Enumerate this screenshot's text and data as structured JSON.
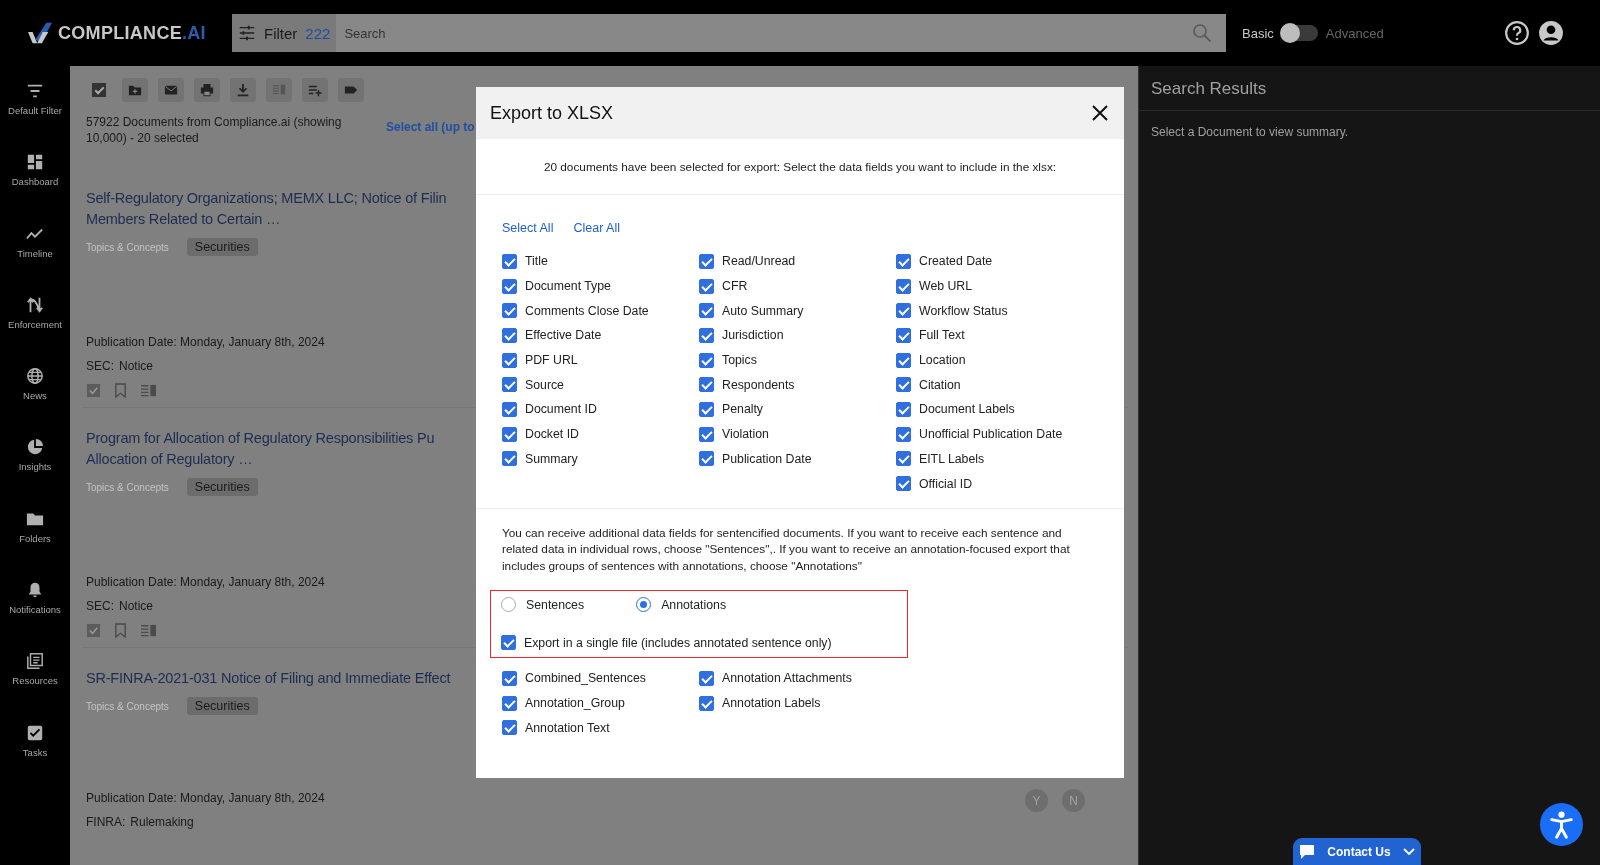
{
  "header": {
    "logo": "COMPLIANCE",
    "logo_suffix": ".AI",
    "filter_label": "Filter",
    "filter_count": "222",
    "search": {
      "placeholder": "Search"
    },
    "mode_toggle": {
      "left_label": "Basic",
      "right_label": "Advanced",
      "on": false
    }
  },
  "sidebar": {
    "items": [
      {
        "label": "Default Filter"
      },
      {
        "label": "Dashboard"
      },
      {
        "label": "Timeline"
      },
      {
        "label": "Enforcement"
      },
      {
        "label": "News"
      },
      {
        "label": "Insights"
      },
      {
        "label": "Folders"
      },
      {
        "label": "Notifications"
      },
      {
        "label": "Resources"
      },
      {
        "label": "Tasks"
      }
    ]
  },
  "results": {
    "select_all_checked": true,
    "summary": "57922 Documents from Compliance.ai (showing 10,000) - 20 selected",
    "select_all_link": "Select all (up to",
    "documents": [
      {
        "title_lines": [
          "Self-Regulatory Organizations; MEMX LLC; Notice of Filin",
          "Members Related to Certain …"
        ],
        "tag_label": "Topics & Concepts",
        "tag": "Securities",
        "publication_date": "Publication Date: Monday, January 8th, 2024",
        "agency": "SEC:",
        "doc_type": "Notice"
      },
      {
        "title_lines": [
          "Program for Allocation of Regulatory Responsibilities Pu",
          "Allocation of Regulatory …"
        ],
        "tag_label": "Topics & Concepts",
        "tag": "Securities",
        "publication_date": "Publication Date: Monday, January 8th, 2024",
        "agency": "SEC:",
        "doc_type": "Notice"
      },
      {
        "title_lines": [
          "SR-FINRA-2021-031 Notice of Filing and Immediate Effect"
        ],
        "tag_label": "Topics & Concepts",
        "tag": "Securities",
        "publication_date": "Publication Date: Monday, January 8th, 2024",
        "agency": "FINRA:",
        "doc_type": "Rulemaking"
      }
    ],
    "feedback": [
      "Y",
      "N"
    ]
  },
  "right_panel": {
    "title": "Search Results",
    "message": "Select a Document to view summary."
  },
  "modal": {
    "title": "Export to XLSX",
    "intro": "20 documents have been selected for export: Select the data fields you want to include in the xlsx:",
    "select_all": "Select All",
    "clear_all": "Clear All",
    "field_columns": [
      [
        {
          "label": "Title",
          "checked": true
        },
        {
          "label": "Document Type",
          "checked": true
        },
        {
          "label": "Comments Close Date",
          "checked": true
        },
        {
          "label": "Effective Date",
          "checked": true
        },
        {
          "label": "PDF URL",
          "checked": true
        },
        {
          "label": "Source",
          "checked": true
        },
        {
          "label": "Document ID",
          "checked": true
        },
        {
          "label": "Docket ID",
          "checked": true
        },
        {
          "label": "Summary",
          "checked": true
        }
      ],
      [
        {
          "label": "Read/Unread",
          "checked": true
        },
        {
          "label": "CFR",
          "checked": true
        },
        {
          "label": "Auto Summary",
          "checked": true
        },
        {
          "label": "Jurisdiction",
          "checked": true
        },
        {
          "label": "Topics",
          "checked": true
        },
        {
          "label": "Respondents",
          "checked": true
        },
        {
          "label": "Penalty",
          "checked": true
        },
        {
          "label": "Violation",
          "checked": true
        },
        {
          "label": "Publication Date",
          "checked": true
        }
      ],
      [
        {
          "label": "Created Date",
          "checked": true
        },
        {
          "label": "Web URL",
          "checked": true
        },
        {
          "label": "Workflow Status",
          "checked": true
        },
        {
          "label": "Full Text",
          "checked": true
        },
        {
          "label": "Location",
          "checked": true
        },
        {
          "label": "Citation",
          "checked": true
        },
        {
          "label": "Document Labels",
          "checked": true
        },
        {
          "label": "Unofficial Publication Date",
          "checked": true
        },
        {
          "label": "EITL Labels",
          "checked": true
        },
        {
          "label": "Official ID",
          "checked": true
        }
      ]
    ],
    "sentence_note": "You can receive additional data fields for sentencified documents. If you want to receive each sentence and related data in individual rows, choose \"Sentences\",. If you want to receive an annotation-focused export that includes groups of sentences with annotations, choose \"Annotations\"",
    "export_modes": [
      {
        "label": "Sentences",
        "selected": false
      },
      {
        "label": "Annotations",
        "selected": true
      }
    ],
    "single_file": {
      "label": "Export in a single file (includes annotated sentence only)",
      "checked": true
    },
    "annotation_columns": [
      [
        {
          "label": "Combined_Sentences",
          "checked": true
        },
        {
          "label": "Annotation_Group",
          "checked": true
        },
        {
          "label": "Annotation Text",
          "checked": true
        }
      ],
      [
        {
          "label": "Annotation Attachments",
          "checked": true
        },
        {
          "label": "Annotation Labels",
          "checked": true
        }
      ]
    ]
  },
  "contact_button": "Contact Us"
}
